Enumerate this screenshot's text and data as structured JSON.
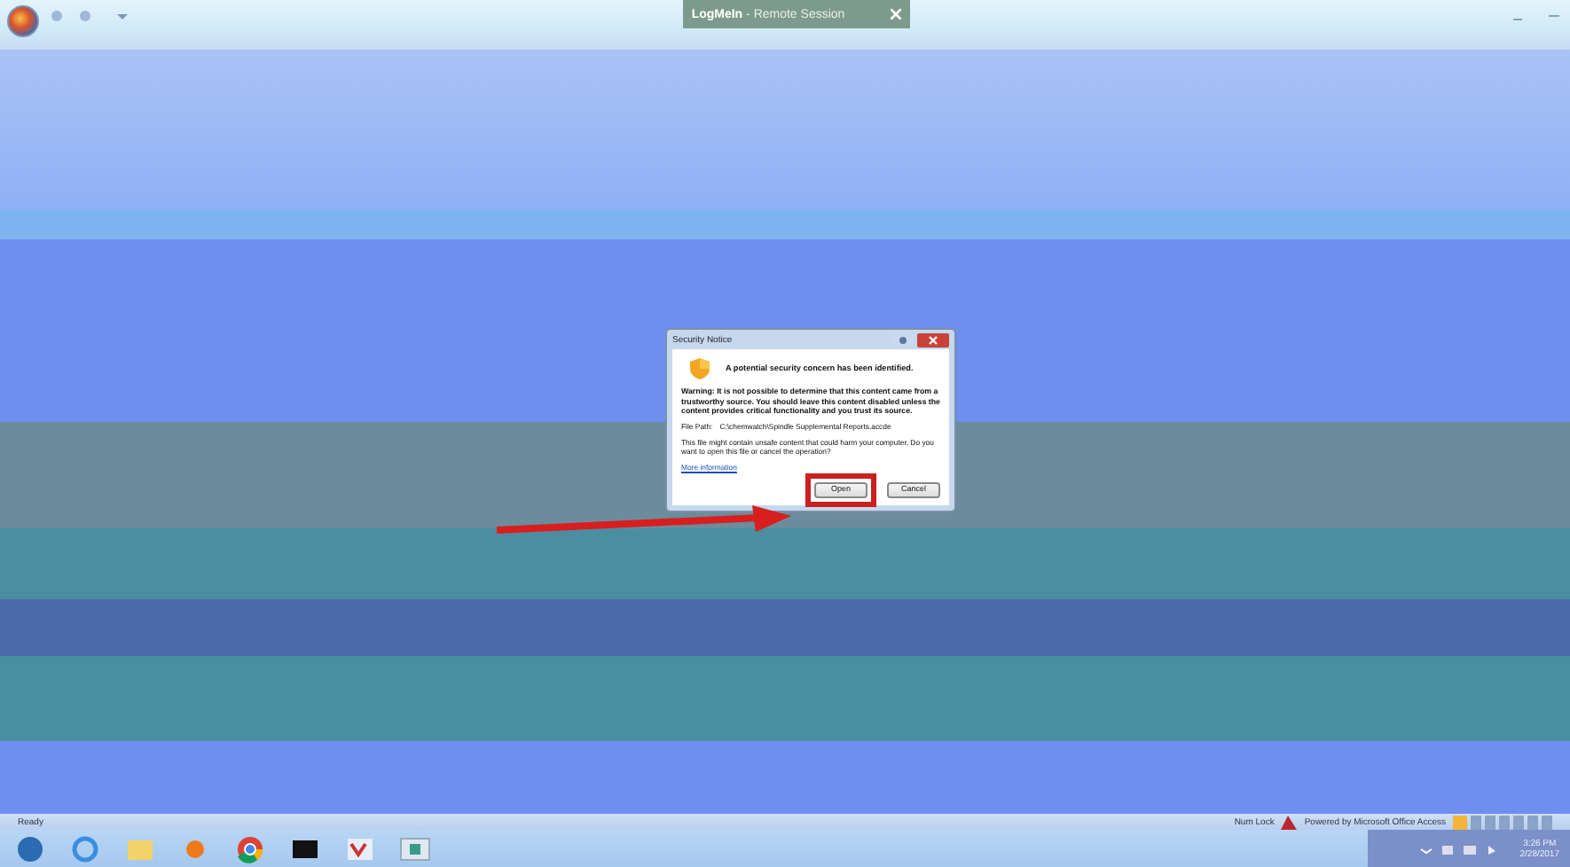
{
  "window": {
    "title": "LogMeIn",
    "subtitle": "- Remote Session"
  },
  "dialog": {
    "title": "Security Notice",
    "headline": "A potential security concern has been identified.",
    "warning": "Warning: It is not possible to determine that this content came from a trustworthy source. You should leave this content disabled unless the content provides critical functionality and you trust its source.",
    "file_path_label": "File Path:",
    "file_path": "C:\\chemwatch\\Spindle Supplemental Reports.accde",
    "message": "This file might contain unsafe content that could harm your computer. Do you want to open this file or cancel the operation?",
    "link": "More information",
    "buttons": [
      {
        "label": "Open",
        "highlighted": true
      },
      {
        "label": "Cancel",
        "highlighted": false
      }
    ]
  },
  "status_bar": {
    "left": "Ready",
    "num_lock": "Num Lock",
    "powered_by": "Powered by Microsoft Office Access"
  },
  "taskbar": {
    "time": "3:26 PM",
    "date": "2/28/2017"
  }
}
